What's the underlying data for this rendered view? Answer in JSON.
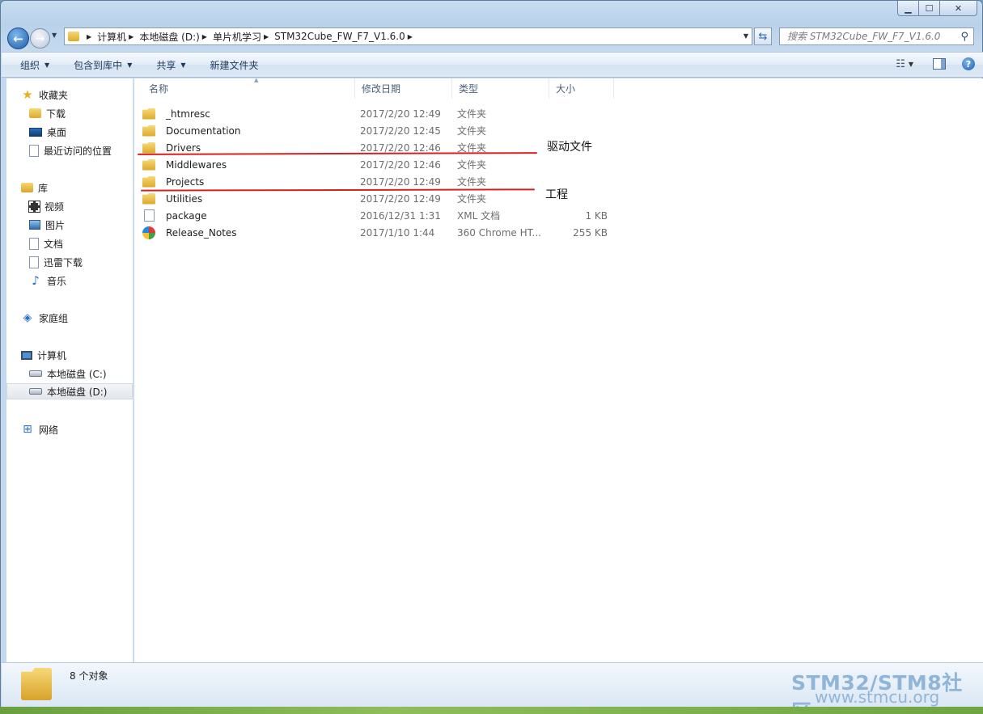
{
  "window": {
    "minimize": "▁",
    "maximize": "☐",
    "close": "✕"
  },
  "address": {
    "crumbs": [
      "计算机",
      "本地磁盘 (D:)",
      "单片机学习",
      "STM32Cube_FW_F7_V1.6.0"
    ]
  },
  "search": {
    "placeholder": "搜索 STM32Cube_FW_F7_V1.6.0"
  },
  "toolbar": {
    "organize": "组织",
    "include_library": "包含到库中",
    "share": "共享",
    "new_folder": "新建文件夹"
  },
  "nav": {
    "favorites": "收藏夹",
    "downloads": "下载",
    "desktop": "桌面",
    "recent": "最近访问的位置",
    "libraries": "库",
    "videos": "视频",
    "pictures": "图片",
    "documents": "文档",
    "xunlei": "迅雷下载",
    "music": "音乐",
    "homegroup": "家庭组",
    "computer": "计算机",
    "drive_c": "本地磁盘 (C:)",
    "drive_d": "本地磁盘 (D:)",
    "network": "网络"
  },
  "columns": {
    "name": "名称",
    "modified": "修改日期",
    "type": "类型",
    "size": "大小"
  },
  "files": [
    {
      "name": "_htmresc",
      "modified": "2017/2/20 12:49",
      "type": "文件夹",
      "size": "",
      "icon": "folder-icon"
    },
    {
      "name": "Documentation",
      "modified": "2017/2/20 12:45",
      "type": "文件夹",
      "size": "",
      "icon": "folder-icon"
    },
    {
      "name": "Drivers",
      "modified": "2017/2/20 12:46",
      "type": "文件夹",
      "size": "",
      "icon": "folder-icon"
    },
    {
      "name": "Middlewares",
      "modified": "2017/2/20 12:46",
      "type": "文件夹",
      "size": "",
      "icon": "folder-icon"
    },
    {
      "name": "Projects",
      "modified": "2017/2/20 12:49",
      "type": "文件夹",
      "size": "",
      "icon": "folder-icon"
    },
    {
      "name": "Utilities",
      "modified": "2017/2/20 12:49",
      "type": "文件夹",
      "size": "",
      "icon": "folder-icon"
    },
    {
      "name": "package",
      "modified": "2016/12/31 1:31",
      "type": "XML 文档",
      "size": "1 KB",
      "icon": "xml-file-icon"
    },
    {
      "name": "Release_Notes",
      "modified": "2017/1/10 1:44",
      "type": "360 Chrome HT...",
      "size": "255 KB",
      "icon": "chrome-html-icon"
    }
  ],
  "annotations": {
    "drivers": "驱动文件",
    "projects": "工程",
    "color": "#d62020"
  },
  "status": {
    "count": "8 个对象"
  },
  "watermark": {
    "line1": "STM32/STM8社区",
    "line2": "www.stmcu.org"
  }
}
